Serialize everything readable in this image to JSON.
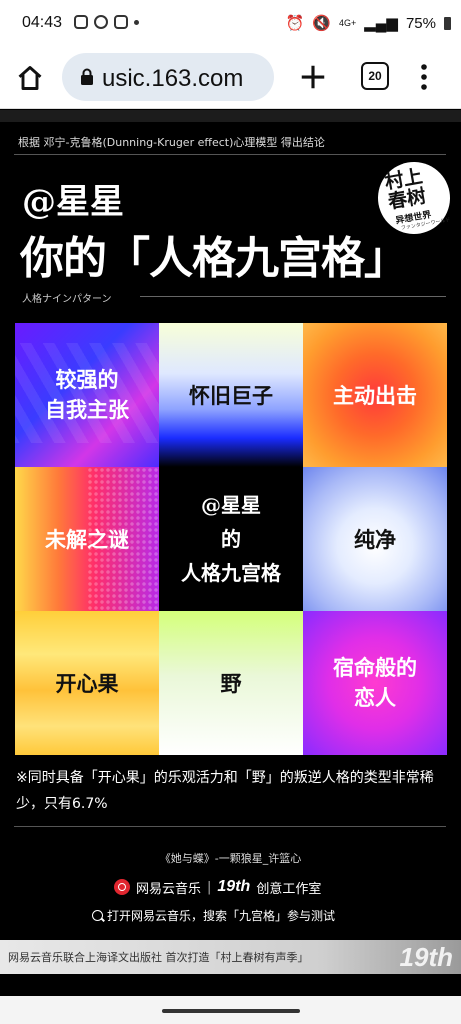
{
  "status": {
    "time": "04:43",
    "battery": "75%",
    "network": "4G+"
  },
  "browser": {
    "url": "usic.163.com",
    "tab_count": "20"
  },
  "page": {
    "theory_line": "根据 邓宁-克鲁格(Dunning-Kruger effect)心理模型 得出结论",
    "username": "@星星",
    "title": "你的「人格九宫格」",
    "subtitle": "人格ナインパターン",
    "badge": {
      "line1": "村上",
      "line2": "春树",
      "line3": "异想世界",
      "line4": "ファンタジーワールド"
    },
    "grid": [
      "较强的\n自我主张",
      "怀旧巨子",
      "主动出击",
      "未解之谜",
      "@星星\n的\n人格九宫格",
      "纯净",
      "开心果",
      "野",
      "宿命般的\n恋人"
    ],
    "note": "※同时具备「开心果」的乐观活力和「野」的叛逆人格的类型非常稀少，只有6.7%",
    "song_line": "《她与蝶》-一颗狼星_许篮心",
    "brand_netease": "网易云音乐",
    "brand_sep": "|",
    "brand_19th": "19th",
    "brand_studio": "创意工作室",
    "search_hint": "打开网易云音乐，搜索「九宫格」参与测试",
    "footer_text": "网易云音乐联合上海译文出版社 首次打造「村上春树有声季」",
    "footer_logo": "19th"
  }
}
